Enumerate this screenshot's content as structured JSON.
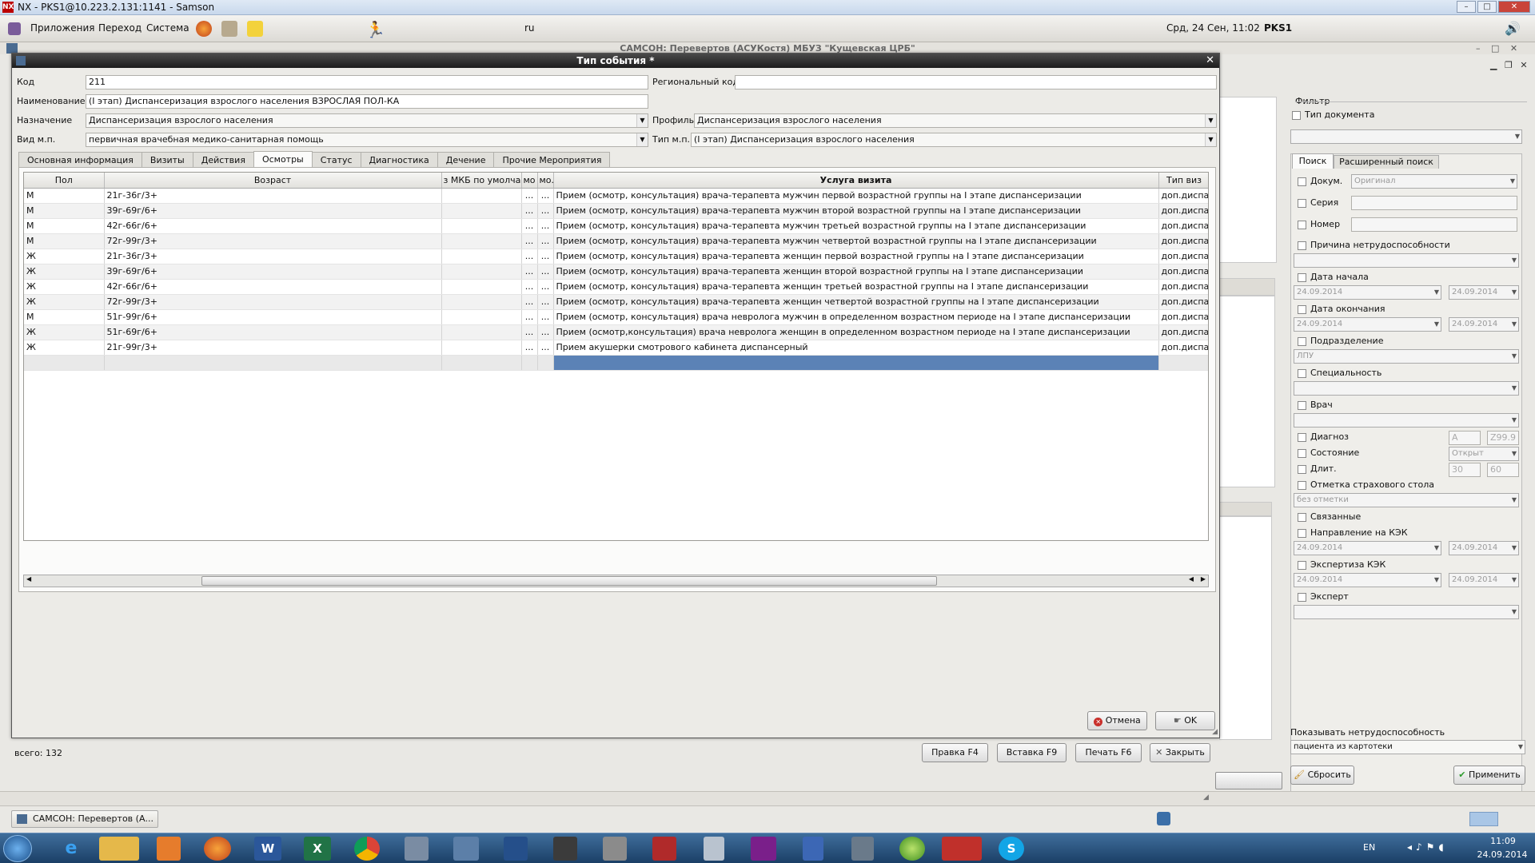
{
  "nx_window": {
    "title": "NX - PKS1@10.223.2.131:1141 - Samson"
  },
  "panel": {
    "menus": [
      "Приложения",
      "Переход",
      "Система"
    ],
    "lang": "ru",
    "datetime": "Срд, 24 Сен, 11:02",
    "user": "PKS1"
  },
  "app": {
    "title": "САМСОН: Перевертов (АСУКостя) МБУЗ \"Кущевская ЦРБ\""
  },
  "dialog": {
    "title": "Тип события *",
    "code_label": "Код",
    "code_value": "211",
    "regional_code_label": "Региональный код",
    "regional_code_value": "",
    "name_label": "Наименование",
    "name_value": "(I этап) Диспансеризация взрослого населения ВЗРОСЛАЯ ПОЛ-КА",
    "purpose_label": "Назначение",
    "purpose_value": "Диспансеризация взрослого населения",
    "profile_label": "Профиль",
    "profile_value": "Диспансеризация взрослого населения",
    "mp_kind_label": "Вид м.п.",
    "mp_kind_value": "первичная врачебная медико-санитарная помощь",
    "mp_type_label": "Тип м.п.",
    "mp_type_value": "(I этап) Диспансеризация взрослого населения",
    "tabs": [
      "Основная информация",
      "Визиты",
      "Действия",
      "Осмотры",
      "Статус",
      "Диагностика",
      "Дечение",
      "Прочие Мероприятия"
    ],
    "active_tab": "Осмотры",
    "table": {
      "columns": [
        "Пол",
        "Возраст",
        "з МКБ по умолчан",
        "мо",
        "мо.",
        "Услуга визита",
        "Тип виз"
      ],
      "rows": [
        {
          "sex": "М",
          "age": "21г-36г/3+",
          "mkb": "",
          "m1": "...",
          "m2": "...",
          "service": "Прием (осмотр, консультация) врача-терапевта мужчин первой возрастной группы на I этапе диспансеризации",
          "type": "доп.диспа"
        },
        {
          "sex": "М",
          "age": "39г-69г/6+",
          "mkb": "",
          "m1": "...",
          "m2": "...",
          "service": "Прием (осмотр, консультация) врача-терапевта мужчин второй возрастной группы на I этапе диспансеризации",
          "type": "доп.диспа"
        },
        {
          "sex": "М",
          "age": "42г-66г/6+",
          "mkb": "",
          "m1": "...",
          "m2": "...",
          "service": "Прием (осмотр, консультация) врача-терапевта мужчин третьей возрастной группы на I этапе диспансеризации",
          "type": "доп.диспа"
        },
        {
          "sex": "М",
          "age": "72г-99г/3+",
          "mkb": "",
          "m1": "...",
          "m2": "...",
          "service": "Прием (осмотр, консультация) врача-терапевта мужчин четвертой возрастной группы на I этапе диспансеризации",
          "type": "доп.диспа"
        },
        {
          "sex": "Ж",
          "age": "21г-36г/3+",
          "mkb": "",
          "m1": "...",
          "m2": "...",
          "service": "Прием (осмотр, консультация) врача-терапевта женщин первой возрастной группы на I этапе диспансеризации",
          "type": "доп.диспа"
        },
        {
          "sex": "Ж",
          "age": "39г-69г/6+",
          "mkb": "",
          "m1": "...",
          "m2": "...",
          "service": "Прием (осмотр, консультация) врача-терапевта женщин второй возрастной группы на I этапе диспансеризации",
          "type": "доп.диспа"
        },
        {
          "sex": "Ж",
          "age": "42г-66г/6+",
          "mkb": "",
          "m1": "...",
          "m2": "...",
          "service": "Прием (осмотр, консультация) врача-терапевта женщин третьей возрастной группы на I этапе диспансеризации",
          "type": "доп.диспа"
        },
        {
          "sex": "Ж",
          "age": "72г-99г/3+",
          "mkb": "",
          "m1": "...",
          "m2": "...",
          "service": "Прием (осмотр, консультация) врача-терапевта женщин четвертой возрастной группы на I этапе диспансеризации",
          "type": "доп.диспа"
        },
        {
          "sex": "М",
          "age": "51г-99г/6+",
          "mkb": "",
          "m1": "...",
          "m2": "...",
          "service": "Прием (осмотр, консультация) врача невролога мужчин в определенном возрастном периоде на I этапе диспансеризации",
          "type": "доп.диспа"
        },
        {
          "sex": "Ж",
          "age": "51г-69г/6+",
          "mkb": "",
          "m1": "...",
          "m2": "...",
          "service": "Прием (осмотр,консультация) врача невролога женщин в определенном возрастном периоде на I этапе диспансеризации",
          "type": "доп.диспа"
        },
        {
          "sex": "Ж",
          "age": "21г-99г/3+",
          "mkb": "",
          "m1": "...",
          "m2": "...",
          "service": "Прием акушерки смотрового кабинета диспансерный",
          "type": "доп.диспа"
        }
      ]
    },
    "cancel_label": "Отмена",
    "ok_label": "OK"
  },
  "main": {
    "total": "всего: 132",
    "edit_label": "Правка F4",
    "insert_label": "Вставка F9",
    "print_label": "Печать F6",
    "close_label": "Закрыть"
  },
  "filter": {
    "title": "Фильтр",
    "doc_type_label": "Тип документа",
    "tabs": [
      "Поиск",
      "Расширенный поиск"
    ],
    "doc_label": "Докум.",
    "doc_value": "Оригинал",
    "series_label": "Серия",
    "number_label": "Номер",
    "incapacity_reason_label": "Причина нетрудоспособности",
    "start_date_label": "Дата начала",
    "end_date_label": "Дата окончания",
    "date_value": "24.09.2014",
    "department_label": "Подразделение",
    "department_value": "ЛПУ",
    "specialty_label": "Специальность",
    "doctor_label": "Врач",
    "diagnosis_label": "Диагноз",
    "diag_from": "A",
    "diag_to": "Z99.9",
    "state_label": "Состояние",
    "state_value": "Открыт",
    "duration_label": "Длит.",
    "dur_from": "30",
    "dur_to": "60",
    "insurance_mark_label": "Отметка страхового стола",
    "insurance_mark_value": "без отметки",
    "linked_label": "Связанные",
    "kek_direction_label": "Направление на КЭК",
    "kek_expertise_label": "Экспертиза КЭК",
    "expert_label": "Эксперт",
    "show_incapacity_label": "Показывать нетрудоспособность",
    "show_incapacity_value": "пациента из картотеки",
    "reset_label": "Сбросить",
    "apply_label": "Применить"
  },
  "bottom_task": {
    "label": "САМСОН: Перевертов (А..."
  },
  "win_taskbar": {
    "lang": "EN",
    "time": "11:09",
    "date": "24.09.2014"
  }
}
